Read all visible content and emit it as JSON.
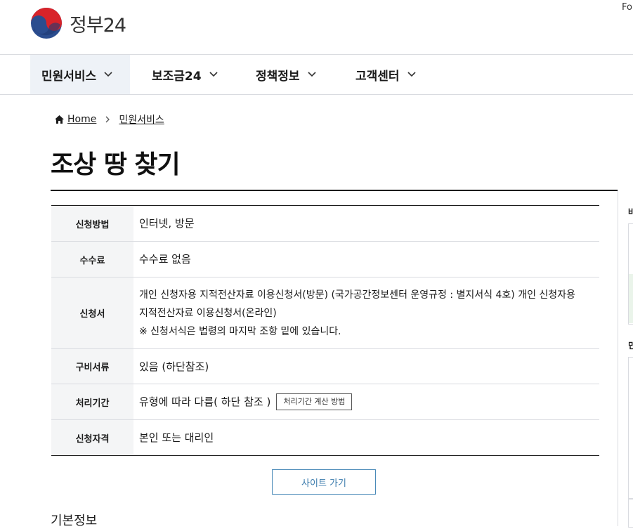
{
  "header": {
    "logo_text": "정부24",
    "font_size_button": "Fo"
  },
  "gnb": {
    "items": [
      {
        "label": "민원서비스",
        "active": true
      },
      {
        "label": "보조금24",
        "active": false
      },
      {
        "label": "정책정보",
        "active": false
      },
      {
        "label": "고객센터",
        "active": false
      }
    ]
  },
  "breadcrumb": {
    "home": "Home",
    "current": "민원서비스"
  },
  "page": {
    "title": "조상 땅 찾기"
  },
  "info_table": {
    "method_label": "신청방법",
    "method_value": "인터넷, 방문",
    "fee_label": "수수료",
    "fee_value": "수수료 없음",
    "form_label": "신청서",
    "form_line1": "개인 신청자용 지적전산자료 이용신청서(방문) (국가공간정보센터 운영규정 : 별지서식 4호) 개인 신청자용",
    "form_line2": "지적전산자료 이용신청서(온라인)",
    "form_note": "※ 신청서식은 법령의 마지막 조항 밑에 있습니다.",
    "docs_label": "구비서류",
    "docs_value": "있음 (하단참조)",
    "period_label": "처리기간",
    "period_value": "유형에 따라 다름( 하단 참조 )",
    "period_button": "처리기간 계산 방법",
    "eligibility_label": "신청자격",
    "eligibility_value": "본인 또는 대리인"
  },
  "actions": {
    "site_button": "사이트 가기"
  },
  "sections": {
    "basic_info": "기본정보"
  },
  "sidebar": {
    "label1": "바",
    "label2": "민"
  },
  "colors": {
    "accent_blue": "#3c7cad",
    "active_nav_bg": "#eef2f7",
    "th_bg": "#f4f5f6",
    "logo_red": "#d8232a",
    "logo_blue": "#2b4d8f"
  }
}
